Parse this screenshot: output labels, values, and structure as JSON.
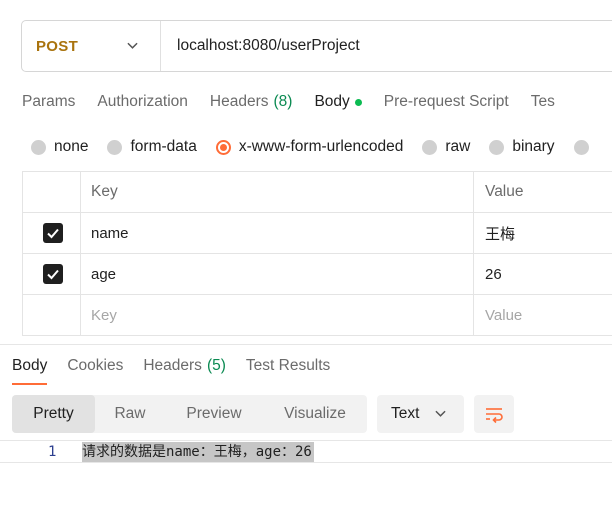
{
  "request": {
    "method": "POST",
    "url": "localhost:8080/userProject"
  },
  "request_tabs": [
    {
      "label": "Params"
    },
    {
      "label": "Authorization"
    },
    {
      "label": "Headers",
      "count": "(8)"
    },
    {
      "label": "Body",
      "active": true
    },
    {
      "label": "Pre-request Script"
    },
    {
      "label": "Tes"
    }
  ],
  "body_types": [
    {
      "label": "none"
    },
    {
      "label": "form-data"
    },
    {
      "label": "x-www-form-urlencoded",
      "checked": true
    },
    {
      "label": "raw"
    },
    {
      "label": "binary"
    }
  ],
  "params_table": {
    "headers": {
      "key": "Key",
      "value": "Value"
    },
    "rows": [
      {
        "checked": true,
        "key": "name",
        "value": "王梅"
      },
      {
        "checked": true,
        "key": "age",
        "value": "26"
      }
    ],
    "placeholder": {
      "key": "Key",
      "value": "Value"
    }
  },
  "response_tabs": [
    {
      "label": "Body",
      "active": true
    },
    {
      "label": "Cookies"
    },
    {
      "label": "Headers",
      "count": "(5)"
    },
    {
      "label": "Test Results"
    }
  ],
  "view_modes": [
    {
      "label": "Pretty",
      "active": true
    },
    {
      "label": "Raw"
    },
    {
      "label": "Preview"
    },
    {
      "label": "Visualize"
    }
  ],
  "format": "Text",
  "response_body": {
    "line_number": "1",
    "text": "请求的数据是name：王梅，age：26"
  },
  "colors": {
    "method": "#a9730d",
    "accent": "#ff6c37",
    "count": "#0b8a52",
    "dot": "#0cbb52"
  },
  "icons": {
    "method_dropdown": "chevron-down-icon",
    "format_dropdown": "chevron-down-icon",
    "wrap": "wrap-lines-icon",
    "check": "checkmark-icon"
  }
}
